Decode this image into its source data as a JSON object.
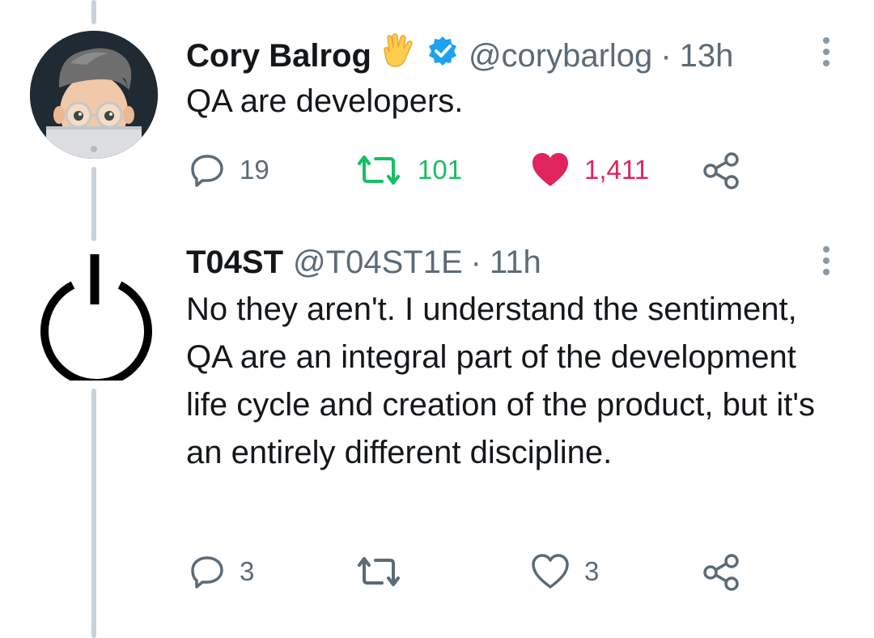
{
  "tweets": [
    {
      "name": "Cory Balrog",
      "handle": "@corybarlog",
      "separator": "·",
      "time": "13h",
      "text": "QA are developers.",
      "replies": "19",
      "retweets": "101",
      "likes": "1,411",
      "retweeted": true,
      "liked": true,
      "badges": [
        "vulcan-salute-emoji",
        "verified-badge-icon"
      ],
      "avatar": "memoji-avatar"
    },
    {
      "name": "T04ST",
      "handle": "@T04ST1E",
      "separator": "·",
      "time": "11h",
      "text": "No they aren't. I understand the sentiment, QA are an integral part of the development life cycle and creation of the product, but it's an entirely different discipline.",
      "replies": "3",
      "retweets": "",
      "likes": "3",
      "retweeted": false,
      "liked": false,
      "avatar": "power-symbol-avatar"
    }
  ],
  "colors": {
    "verified": "#1da1f2",
    "retweet": "#17bf63",
    "like": "#e0245e",
    "muted": "#5b6b77",
    "text": "#14171a",
    "thread_line": "#c9d1d8"
  }
}
